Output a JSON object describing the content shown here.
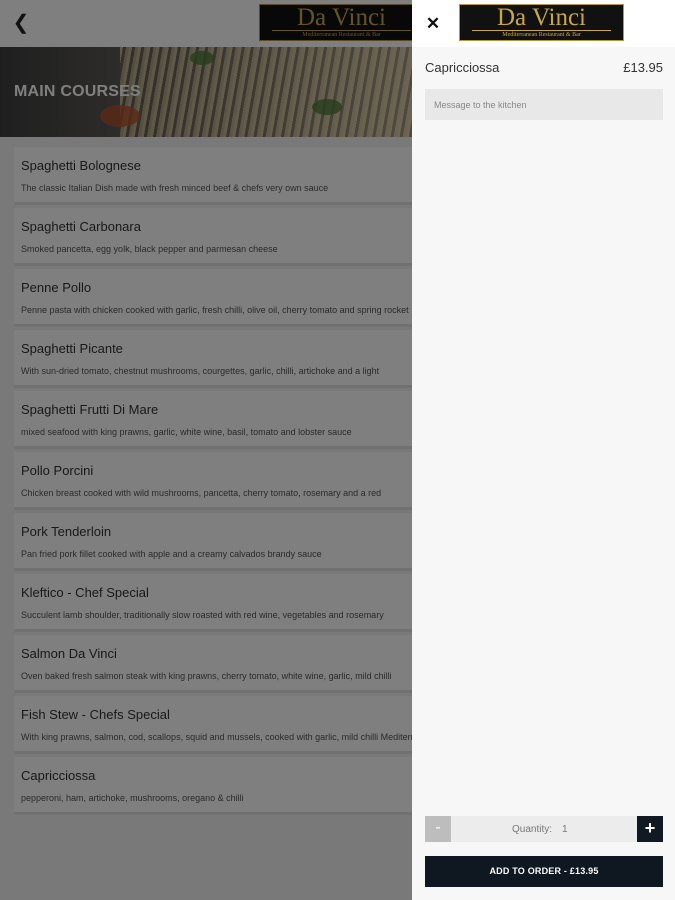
{
  "topbar": {
    "back_icon": "arrow-left-icon",
    "logo_name": "Da Vinci",
    "logo_sub": "Mediterranean Restaurant & Bar"
  },
  "hero": {
    "title": "MAIN COURSES"
  },
  "menu": {
    "items": [
      {
        "name": "Spaghetti Bolognese",
        "desc": "The classic Italian Dish made with fresh minced beef & chefs very own sauce"
      },
      {
        "name": "Spaghetti Carbonara",
        "desc": "Smoked pancetta, egg yolk, black pepper and parmesan cheese"
      },
      {
        "name": "Penne Pollo",
        "desc": "Penne pasta with chicken cooked with garlic, fresh chilli, olive oil, cherry tomato and spring rocket"
      },
      {
        "name": "Spaghetti Picante",
        "desc": "With sun-dried tomato, chestnut mushrooms, courgettes, garlic, chilli, artichoke and a light"
      },
      {
        "name": "Spaghetti Frutti Di Mare",
        "desc": "mixed seafood with king prawns, garlic, white wine, basil, tomato and lobster sauce"
      },
      {
        "name": "Pollo Porcini",
        "desc": "Chicken breast cooked with wild mushrooms, pancetta, cherry tomato, rosemary and a red"
      },
      {
        "name": "Pork Tenderloin",
        "desc": "Pan fried pork fillet cooked with apple and a creamy calvados brandy sauce"
      },
      {
        "name": "Kleftico - Chef Special",
        "desc": "Succulent lamb shoulder, traditionally slow roasted with red wine, vegetables and rosemary"
      },
      {
        "name": "Salmon Da Vinci",
        "desc": "Oven baked fresh salmon steak with king prawns, cherry tomato, white wine, garlic, mild chilli"
      },
      {
        "name": "Fish Stew - Chefs Special",
        "desc": "With king prawns, salmon, cod, scallops, squid and mussels, cooked with garlic, mild chilli Mediterranean bread."
      },
      {
        "name": "Capricciossa",
        "desc": "pepperoni, ham, artichoke, mushrooms, oregano & chilli"
      }
    ]
  },
  "panel": {
    "close_icon": "close-icon",
    "logo_name": "Da Vinci",
    "logo_sub": "Mediterranean Restaurant & Bar",
    "item_name": "Capricciossa",
    "item_price": "£13.95",
    "kitchen_placeholder": "Message to the kitchen",
    "qty_minus": "-",
    "qty_label": "Quantity:",
    "qty_value": "1",
    "qty_plus": "+",
    "add_button": "ADD TO ORDER  -  £13.95"
  }
}
